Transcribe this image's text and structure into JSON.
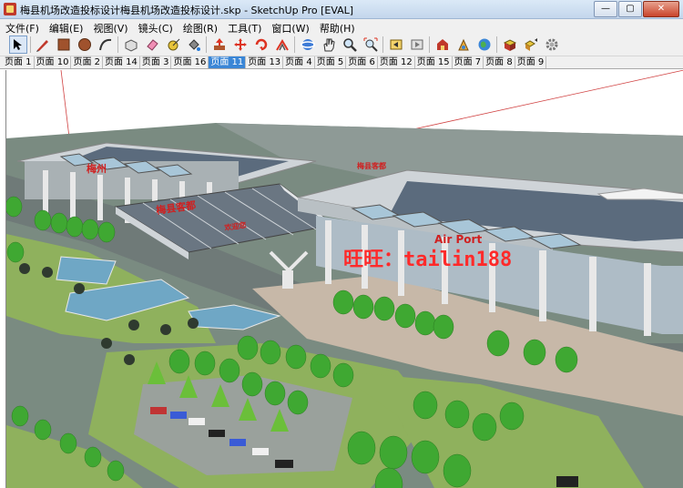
{
  "window": {
    "title": "梅县机场改造投标设计梅县机场改造投标设计.skp - SketchUp Pro [EVAL]",
    "buttons": {
      "minimize": "—",
      "maximize": "▢",
      "close": "✕"
    }
  },
  "menu": [
    "文件(F)",
    "编辑(E)",
    "视图(V)",
    "镜头(C)",
    "绘图(R)",
    "工具(T)",
    "窗口(W)",
    "帮助(H)"
  ],
  "tabs": {
    "items": [
      "页面 1",
      "页面 10",
      "页面 2",
      "页面 14",
      "页面 3",
      "页面 16",
      "页面 11",
      "页面 13",
      "页面 4",
      "页面 5",
      "页面 6",
      "页面 12",
      "页面 15",
      "页面 7",
      "页面 8",
      "页面 9"
    ],
    "active": "页面 11"
  },
  "scene": {
    "signs": {
      "roof_left": "梅州",
      "canopy_cn": "梅县客都",
      "canopy_small": "欢迎您",
      "terminal_top": "梅县客都",
      "terminal_airport": "Air Port"
    },
    "watermark": "旺旺：tailin188"
  },
  "colors": {
    "ground": "#7b8d80",
    "sky": "#ffffff",
    "roof_glass": "#5b6b7d",
    "roof_frame": "#cfd4d8",
    "column": "#e8e8e8",
    "grass": "#8bb05a",
    "tree": "#3fa832",
    "water": "#6fa7c5",
    "watermark": "#ff2a2a",
    "tab_active": "#3a86d6"
  }
}
